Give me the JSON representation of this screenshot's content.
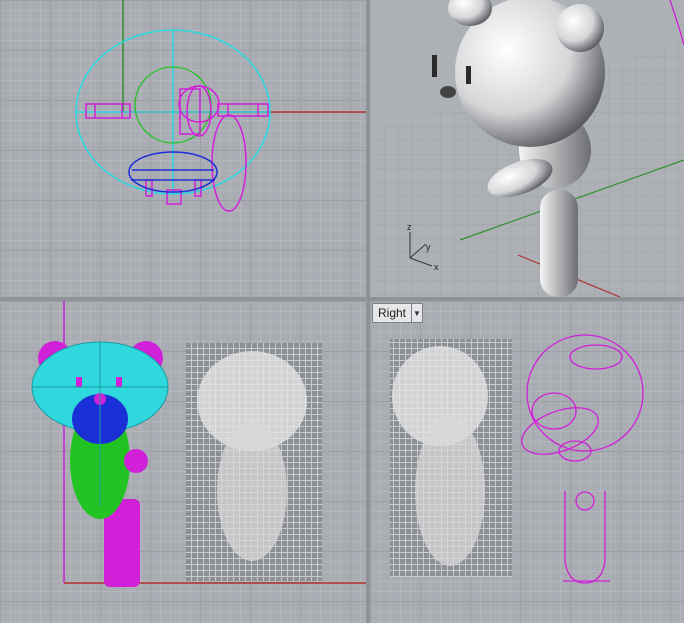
{
  "viewports": {
    "top": {
      "name": ""
    },
    "perspective": {
      "name": "",
      "axes": {
        "z": "z",
        "y": "y",
        "x": "x"
      }
    },
    "front": {
      "name": ""
    },
    "right": {
      "name": "Right",
      "dropdown_icon": "chevron-down-icon"
    }
  },
  "colors": {
    "grid_bg": "#a9adb3",
    "grid_line": "#9d9fa5",
    "axis_x": "#b0302a",
    "axis_y": "#2f8f2f",
    "curve_cyan": "#27d9e0",
    "curve_magenta": "#d020d8",
    "curve_blue": "#1a2fd6",
    "curve_green": "#22c322"
  }
}
